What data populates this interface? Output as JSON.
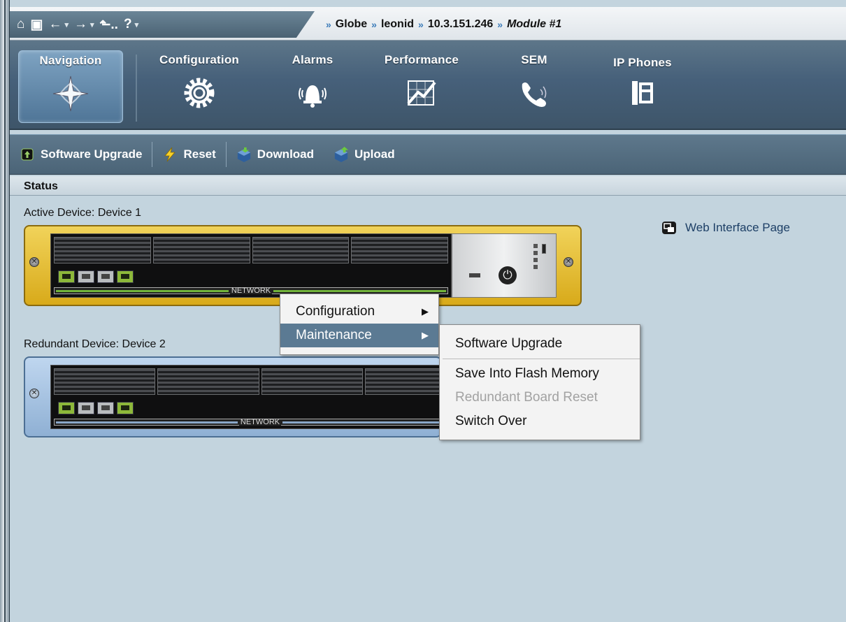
{
  "quick_tools": [
    {
      "icon": "home-icon",
      "glyph": "⌂"
    },
    {
      "icon": "desktop-icon",
      "glyph": "▣"
    },
    {
      "icon": "back-arrow-icon",
      "glyph": "←"
    },
    {
      "icon": "dropdown-icon",
      "glyph": "▾"
    },
    {
      "icon": "forward-arrow-icon",
      "glyph": "→"
    },
    {
      "icon": "dropdown-icon",
      "glyph": "▾"
    },
    {
      "icon": "up-level-icon",
      "glyph": "⬑.."
    },
    {
      "icon": "help-icon",
      "glyph": "?"
    },
    {
      "icon": "dropdown-icon",
      "glyph": "▾"
    }
  ],
  "breadcrumb": {
    "items": [
      "Globe",
      "leonid",
      "10.3.151.246"
    ],
    "current": "Module #1"
  },
  "ribbon_tabs": [
    {
      "label": "Navigation",
      "icon": "compass-star-icon",
      "active": true
    },
    {
      "label": "Configuration",
      "icon": "gear-icon",
      "active": false
    },
    {
      "label": "Alarms",
      "icon": "alarm-bell-icon",
      "active": false
    },
    {
      "label": "Performance",
      "icon": "performance-chart-icon",
      "active": false
    },
    {
      "label": "SEM",
      "icon": "phone-handset-icon",
      "active": false
    },
    {
      "label": "IP Phones",
      "icon": "ip-phone-icon",
      "active": false
    }
  ],
  "toolbar": {
    "software_upgrade": "Software Upgrade",
    "reset": "Reset",
    "download": "Download",
    "upload": "Upload"
  },
  "status": {
    "heading": "Status",
    "active_device_label": "Active Device: Device 1",
    "redundant_device_label": "Redundant Device: Device 2",
    "web_interface_link": "Web Interface Page",
    "network_label": "NETWORK"
  },
  "context_menu": {
    "items": [
      {
        "label": "Configuration",
        "highlighted": false,
        "arrow": "▶"
      },
      {
        "label": "Maintenance",
        "highlighted": true,
        "arrow": "▶"
      }
    ],
    "submenu": [
      {
        "label": "Software Upgrade",
        "enabled": true
      },
      {
        "label": "Save Into Flash Memory",
        "enabled": true
      },
      {
        "label": "Redundant Board Reset",
        "enabled": false
      },
      {
        "label": "Switch Over",
        "enabled": true
      }
    ]
  },
  "colors": {
    "ribbon": "#46607a",
    "active_board": "#e6c030",
    "redundant_board": "#a9c4e2",
    "menu_highlight": "#5b7a93"
  }
}
